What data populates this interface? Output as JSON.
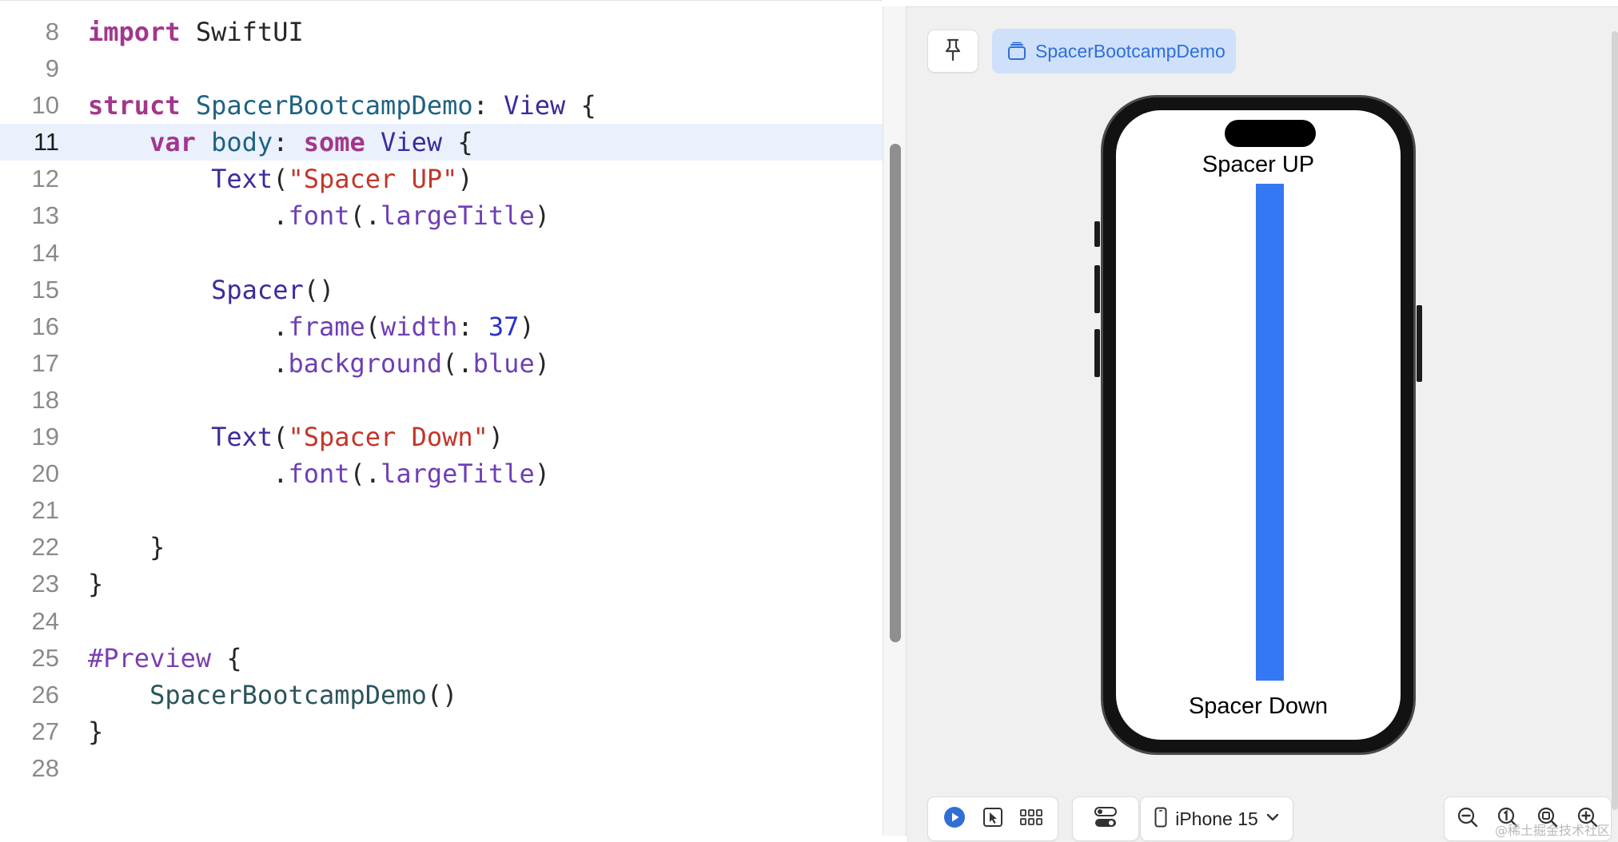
{
  "editor": {
    "active_line": "11",
    "lines": [
      {
        "num": "8",
        "tokens": [
          {
            "t": "import",
            "c": "kw"
          },
          {
            "t": " SwiftUI",
            "c": "pl"
          }
        ]
      },
      {
        "num": "9",
        "tokens": []
      },
      {
        "num": "10",
        "tokens": [
          {
            "t": "struct",
            "c": "kw"
          },
          {
            "t": " ",
            "c": "pl"
          },
          {
            "t": "SpacerBootcampDemo",
            "c": "tn"
          },
          {
            "t": ": ",
            "c": "pl"
          },
          {
            "t": "View",
            "c": "tp"
          },
          {
            "t": " {",
            "c": "pl"
          }
        ]
      },
      {
        "num": "11",
        "tokens": [
          {
            "t": "    ",
            "c": "pl"
          },
          {
            "t": "var",
            "c": "kw"
          },
          {
            "t": " ",
            "c": "pl"
          },
          {
            "t": "body",
            "c": "tn"
          },
          {
            "t": ": ",
            "c": "pl"
          },
          {
            "t": "some",
            "c": "kw"
          },
          {
            "t": " ",
            "c": "pl"
          },
          {
            "t": "View",
            "c": "tp"
          },
          {
            "t": " {",
            "c": "pl"
          }
        ]
      },
      {
        "num": "12",
        "tokens": [
          {
            "t": "        ",
            "c": "pl"
          },
          {
            "t": "Text",
            "c": "tp"
          },
          {
            "t": "(",
            "c": "pl"
          },
          {
            "t": "\"Spacer UP\"",
            "c": "str"
          },
          {
            "t": ")",
            "c": "pl"
          }
        ]
      },
      {
        "num": "13",
        "tokens": [
          {
            "t": "            .",
            "c": "pl"
          },
          {
            "t": "font",
            "c": "fn"
          },
          {
            "t": "(.",
            "c": "pl"
          },
          {
            "t": "largeTitle",
            "c": "fn"
          },
          {
            "t": ")",
            "c": "pl"
          }
        ]
      },
      {
        "num": "14",
        "tokens": []
      },
      {
        "num": "15",
        "tokens": [
          {
            "t": "        ",
            "c": "pl"
          },
          {
            "t": "Spacer",
            "c": "tp"
          },
          {
            "t": "()",
            "c": "pl"
          }
        ]
      },
      {
        "num": "16",
        "tokens": [
          {
            "t": "            .",
            "c": "pl"
          },
          {
            "t": "frame",
            "c": "fn"
          },
          {
            "t": "(",
            "c": "pl"
          },
          {
            "t": "width",
            "c": "fn"
          },
          {
            "t": ": ",
            "c": "pl"
          },
          {
            "t": "37",
            "c": "num"
          },
          {
            "t": ")",
            "c": "pl"
          }
        ]
      },
      {
        "num": "17",
        "tokens": [
          {
            "t": "            .",
            "c": "pl"
          },
          {
            "t": "background",
            "c": "fn"
          },
          {
            "t": "(.",
            "c": "pl"
          },
          {
            "t": "blue",
            "c": "fn"
          },
          {
            "t": ")",
            "c": "pl"
          }
        ]
      },
      {
        "num": "18",
        "tokens": []
      },
      {
        "num": "19",
        "tokens": [
          {
            "t": "        ",
            "c": "pl"
          },
          {
            "t": "Text",
            "c": "tp"
          },
          {
            "t": "(",
            "c": "pl"
          },
          {
            "t": "\"Spacer Down\"",
            "c": "str"
          },
          {
            "t": ")",
            "c": "pl"
          }
        ]
      },
      {
        "num": "20",
        "tokens": [
          {
            "t": "            .",
            "c": "pl"
          },
          {
            "t": "font",
            "c": "fn"
          },
          {
            "t": "(.",
            "c": "pl"
          },
          {
            "t": "largeTitle",
            "c": "fn"
          },
          {
            "t": ")",
            "c": "pl"
          }
        ]
      },
      {
        "num": "21",
        "tokens": []
      },
      {
        "num": "22",
        "tokens": [
          {
            "t": "    }",
            "c": "pl"
          }
        ]
      },
      {
        "num": "23",
        "tokens": [
          {
            "t": "}",
            "c": "pl"
          }
        ]
      },
      {
        "num": "24",
        "tokens": []
      },
      {
        "num": "25",
        "tokens": [
          {
            "t": "#Preview",
            "c": "at"
          },
          {
            "t": " {",
            "c": "pl"
          }
        ]
      },
      {
        "num": "26",
        "tokens": [
          {
            "t": "    ",
            "c": "pl"
          },
          {
            "t": "SpacerBootcampDemo",
            "c": "mc"
          },
          {
            "t": "()",
            "c": "pl"
          }
        ]
      },
      {
        "num": "27",
        "tokens": [
          {
            "t": "}",
            "c": "pl"
          }
        ]
      },
      {
        "num": "28",
        "tokens": []
      }
    ]
  },
  "canvas": {
    "pin_icon": "pin-icon",
    "preview_tab": {
      "icon": "preview-stack-icon",
      "label": "SpacerBootcampDemo"
    },
    "preview": {
      "top_text": "Spacer UP",
      "bottom_text": "Spacer Down",
      "spacer_color": "#3478f6"
    },
    "toolbar": {
      "modes": [
        {
          "icon": "live-play-icon",
          "active": true
        },
        {
          "icon": "selectable-cursor-icon",
          "active": false
        },
        {
          "icon": "variants-grid-icon",
          "active": false
        }
      ],
      "settings_icon": "device-settings-icon",
      "device_label": "iPhone 15",
      "device_icon": "iphone-icon",
      "device_chevron": "chevron-down-icon",
      "zoom": [
        "zoom-out-icon",
        "zoom-100-icon",
        "zoom-fit-icon",
        "zoom-in-icon"
      ]
    },
    "watermark": "@稀土掘金技术社区"
  },
  "colors": {
    "accent": "#2f6fd6",
    "active_line_bg": "#eaf1fd",
    "keyword": "#a2378c",
    "string": "#c2362a"
  }
}
